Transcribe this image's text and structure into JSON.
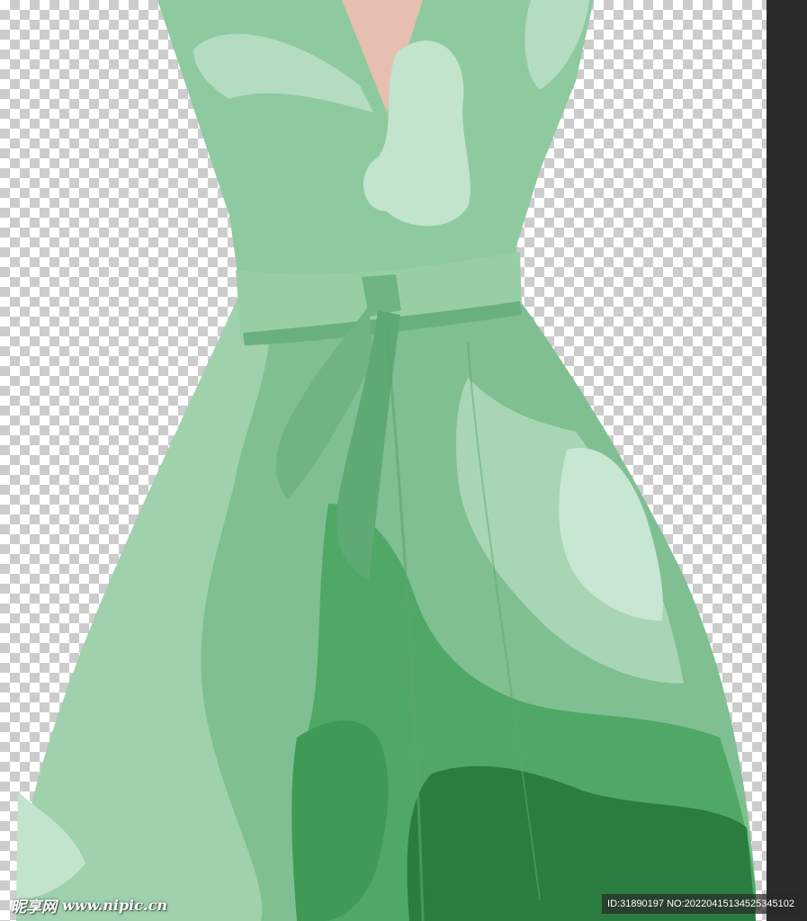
{
  "image": {
    "subject": "green-dress",
    "background": "transparency-checkerboard",
    "colors": {
      "panel": "#2b2b2b",
      "skin": "#e6bfb1",
      "dress_light": "#c2e3cc",
      "dress_mid": "#8fc9a0",
      "dress_base": "#7fbf92",
      "dress_dark": "#3f9a57",
      "dress_deep": "#2a7d3f"
    }
  },
  "watermark": {
    "logo_text": "昵享网",
    "site": "www.nipic.cn",
    "id_text": "ID:31890197 NO:20220415134525345102"
  }
}
